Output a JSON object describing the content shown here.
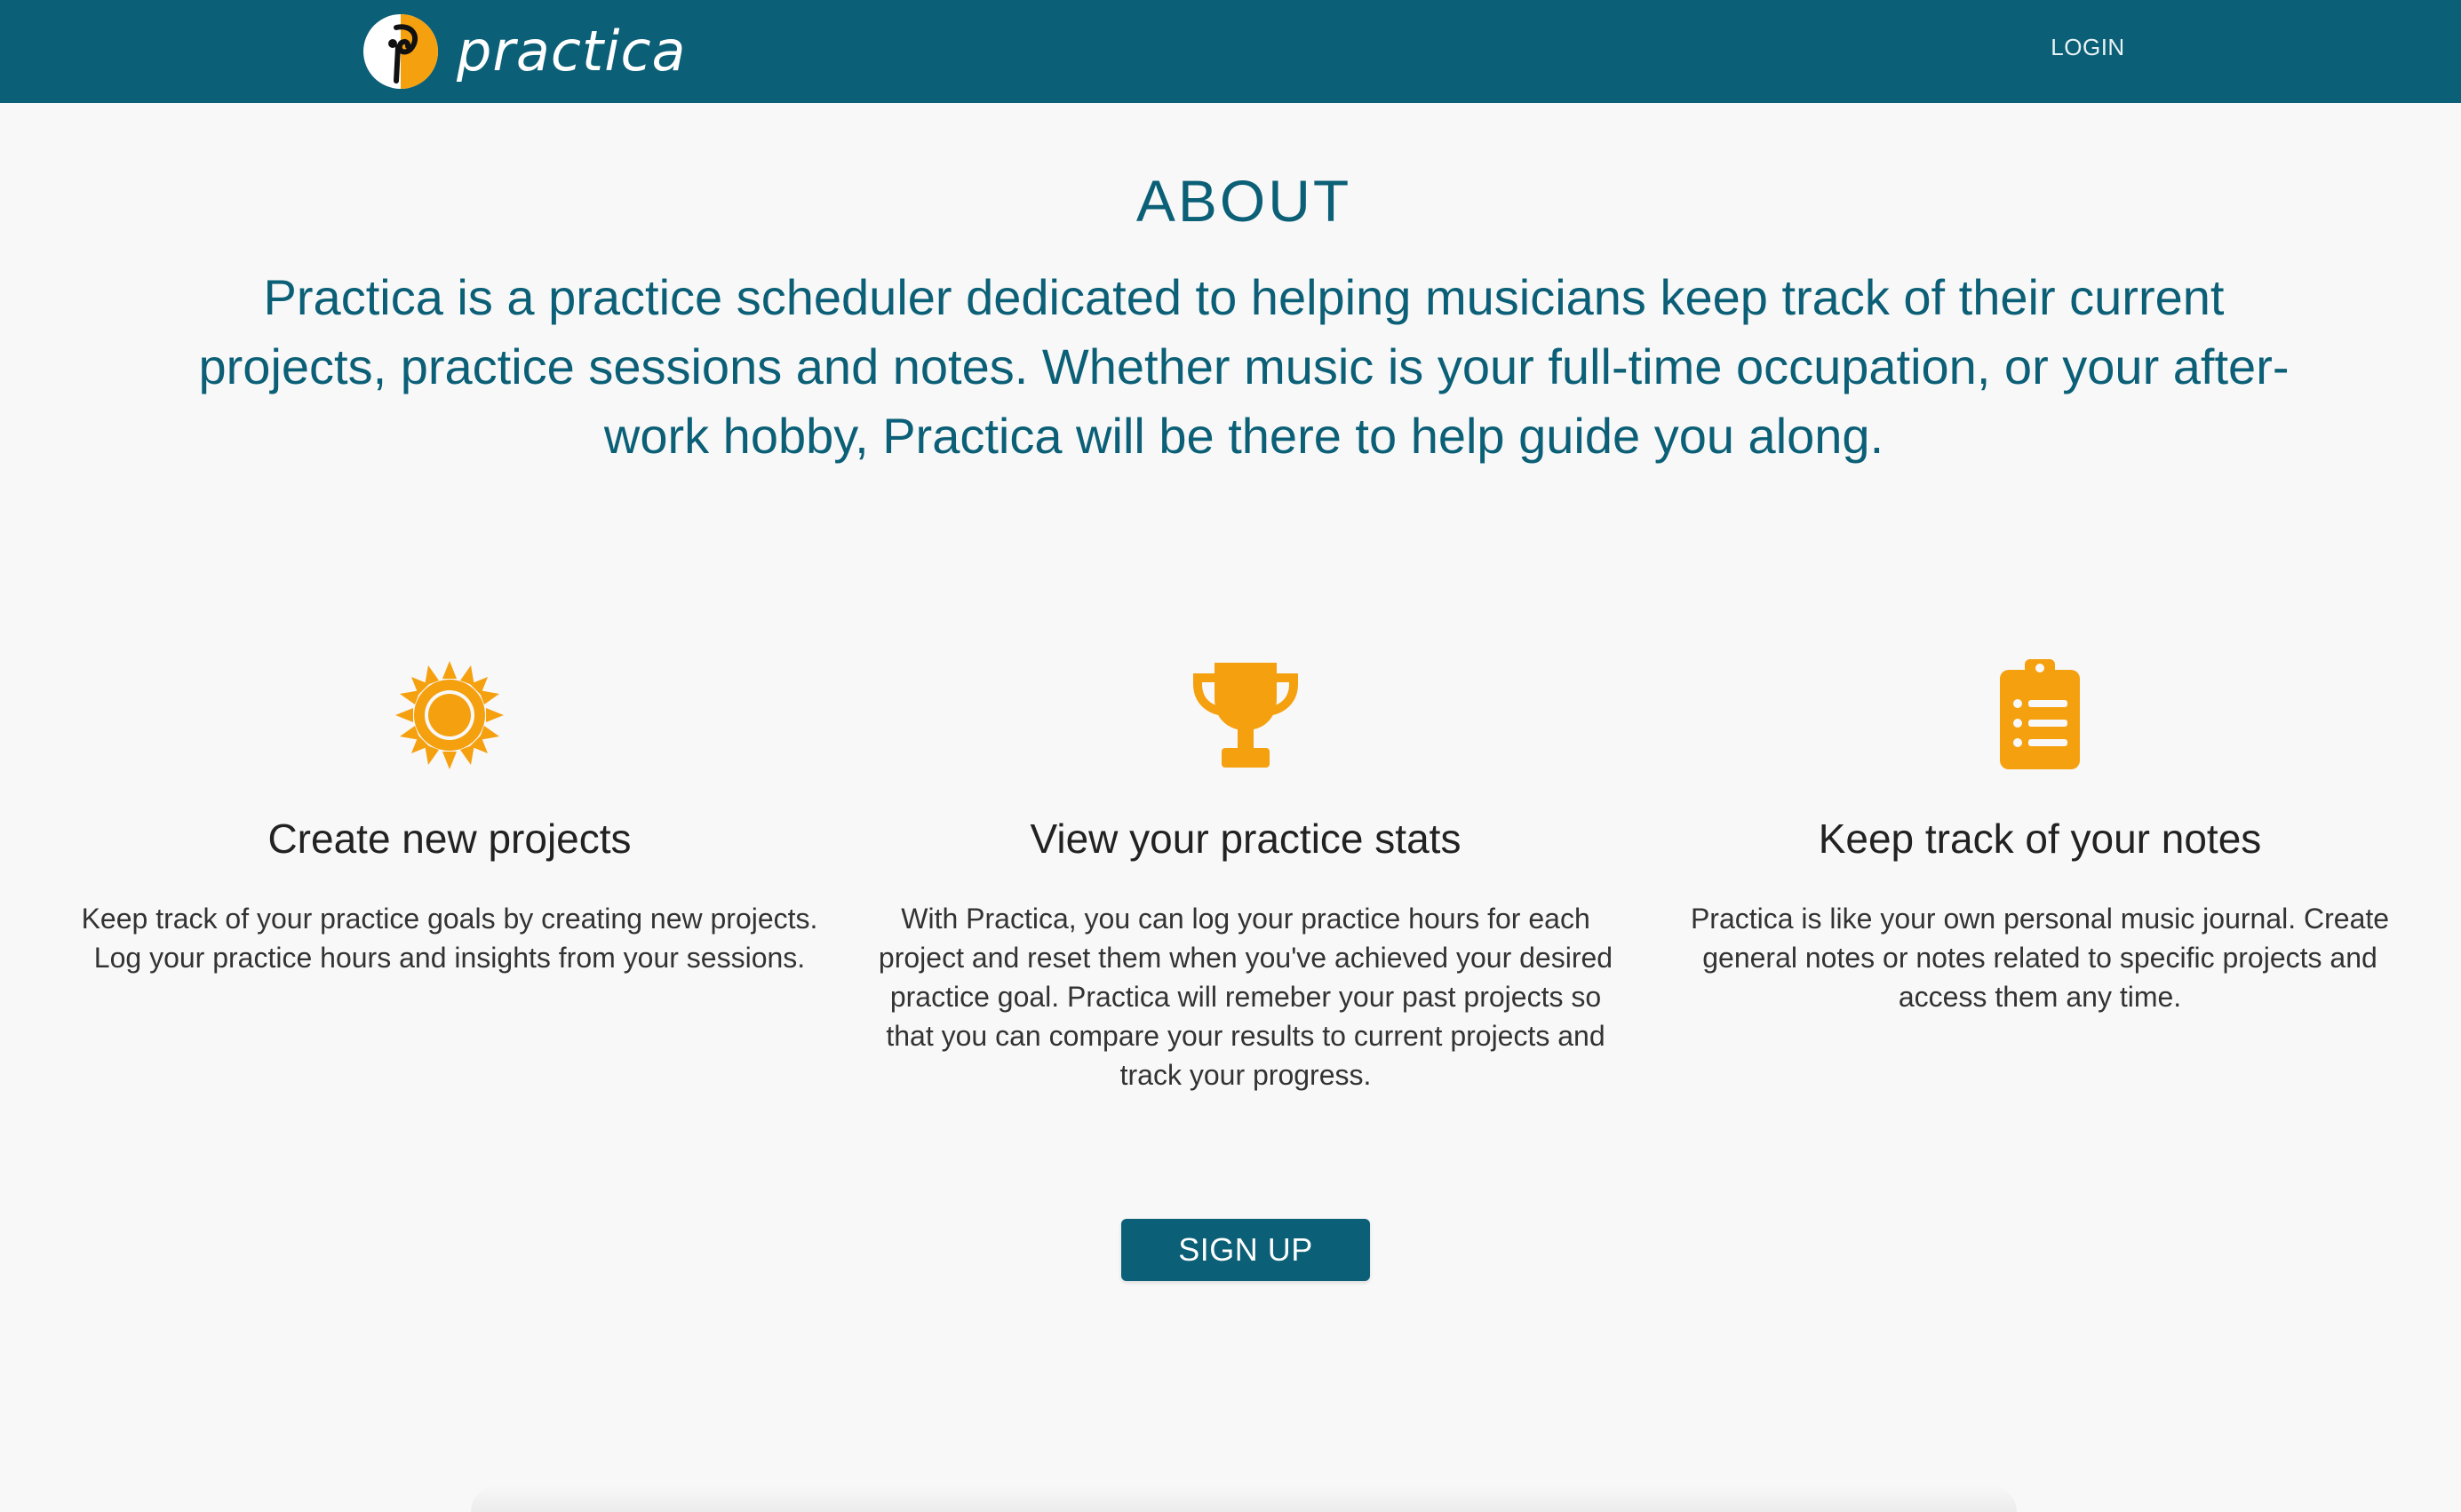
{
  "navbar": {
    "brand_name": "practica",
    "login_label": "LOGIN",
    "background_color": "#0b5f76"
  },
  "about": {
    "title": "ABOUT",
    "text": "Practica is a practice scheduler dedicated to helping musicians keep track of their current projects, practice sessions and notes. Whether music is your full-time occupation, or your after-work hobby, Practica will be there to help guide you along."
  },
  "features": [
    {
      "icon": "sun-icon",
      "title": "Create new projects",
      "description": "Keep track of your practice goals by creating new projects. Log your practice hours and insights from your sessions."
    },
    {
      "icon": "trophy-icon",
      "title": "View your practice stats",
      "description": "With Practica, you can log your practice hours for each project and reset them when you've achieved your desired practice goal. Practica will remeber your past projects so that you can compare your results to current projects and track your progress."
    },
    {
      "icon": "clipboard-list-icon",
      "title": "Keep track of your notes",
      "description": "Practica is like your own personal music journal. Create general notes or notes related to specific projects and access them any time."
    }
  ],
  "signup": {
    "label": "SIGN UP"
  },
  "colors": {
    "primary": "#0b5f76",
    "accent": "#f5a00f",
    "background": "#f8f8f8"
  }
}
